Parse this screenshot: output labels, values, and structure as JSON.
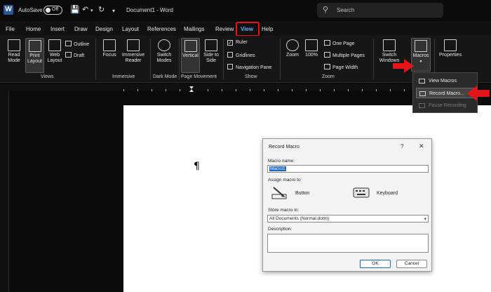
{
  "titlebar": {
    "app_logo": "W",
    "autosave_label": "AutoSave",
    "autosave_state": "Off",
    "document_title": "Document1 - Word",
    "search_placeholder": "Search"
  },
  "menu": {
    "tabs": [
      "File",
      "Home",
      "Insert",
      "Draw",
      "Design",
      "Layout",
      "References",
      "Mailings",
      "Review",
      "View",
      "Help"
    ],
    "active_tab": "View"
  },
  "ribbon": {
    "views": {
      "read_mode": "Read Mode",
      "print_layout": "Print Layout",
      "web_layout": "Web Layout",
      "outline": "Outline",
      "draft": "Draft",
      "group_label": "Views"
    },
    "immersive": {
      "focus": "Focus",
      "immersive_reader": "Immersive Reader",
      "group_label": "Immersive"
    },
    "dark_mode": {
      "switch_modes": "Switch Modes",
      "group_label": "Dark Mode"
    },
    "page_movement": {
      "vertical": "Vertical",
      "side_to_side": "Side to Side",
      "group_label": "Page Movement"
    },
    "show": {
      "ruler": "Ruler",
      "ruler_checked": true,
      "gridlines": "Gridlines",
      "navigation_pane": "Navigation Pane",
      "group_label": "Show"
    },
    "zoom": {
      "zoom": "Zoom",
      "hundred": "100%",
      "one_page": "One Page",
      "multiple_pages": "Multiple Pages",
      "page_width": "Page Width",
      "group_label": "Zoom"
    },
    "window": {
      "switch_windows": "Switch Windows"
    },
    "macros": {
      "macros": "Macros",
      "properties": "Properties"
    }
  },
  "macros_menu": {
    "items": [
      {
        "label": "View Macros",
        "enabled": true
      },
      {
        "label": "Record Macro...",
        "enabled": true,
        "highlighted": true
      },
      {
        "label": "Pause Recording",
        "enabled": false
      }
    ]
  },
  "document": {
    "paragraph_mark": "¶"
  },
  "record_macro_dialog": {
    "title": "Record Macro",
    "help": "?",
    "close": "✕",
    "macro_name_label": "Macro name:",
    "macro_name_value": "Macro1",
    "assign_label": "Assign macro to",
    "button_label": "Button",
    "keyboard_label": "Keyboard",
    "store_label": "Store macro in:",
    "store_value": "All Documents (Normal.dotm)",
    "description_label": "Description:",
    "ok": "OK",
    "cancel": "Cancel"
  },
  "colors": {
    "accent": "#6aaaf7",
    "highlight_red": "#e3151a",
    "selection_blue": "#1a66c9"
  }
}
